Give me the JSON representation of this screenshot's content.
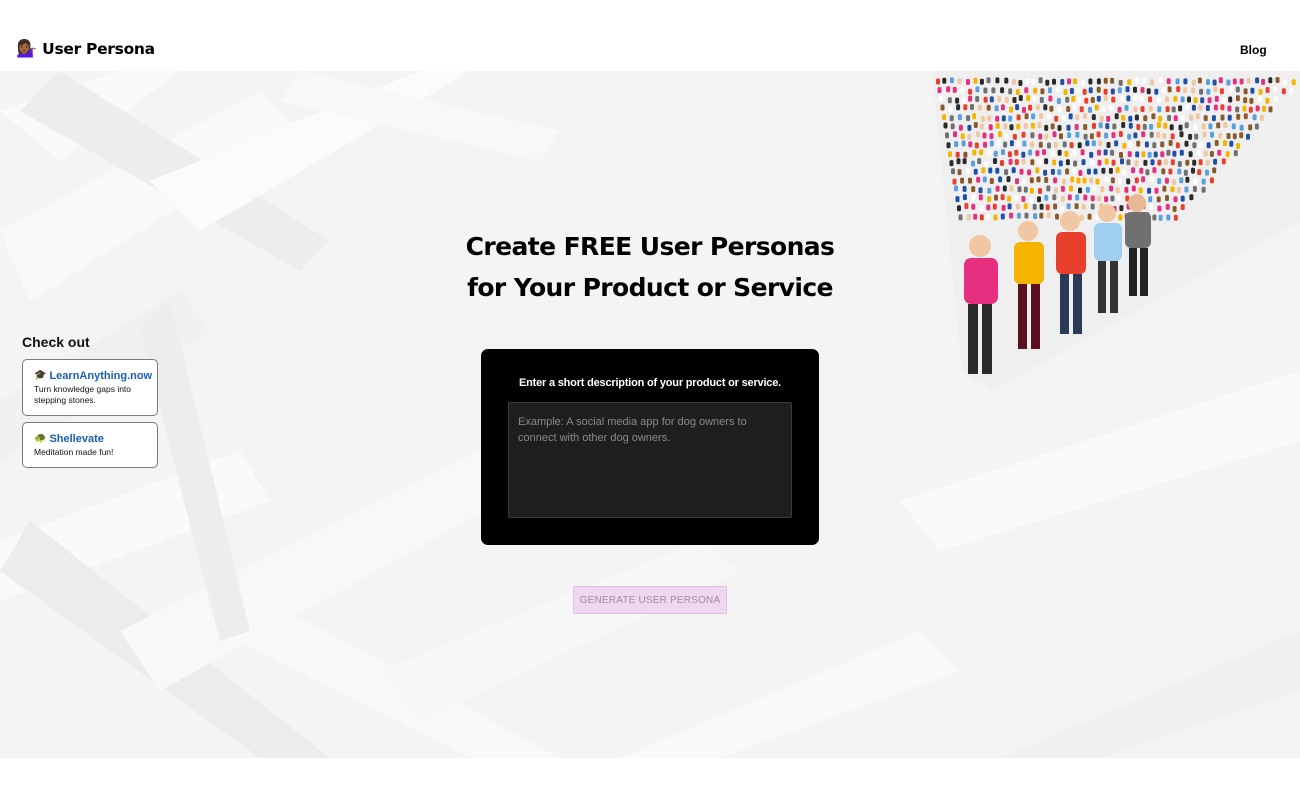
{
  "navbar": {
    "brand_emoji": "💁🏾‍♀️",
    "brand_name": "User Persona",
    "blog_link": "Blog"
  },
  "hero": {
    "headline_line1": "Create FREE User Personas",
    "headline_line2": "for Your Product or Service",
    "crowd_illustration": "crowd-of-people-illustration"
  },
  "checkout": {
    "title": "Check out",
    "items": [
      {
        "icon": "🎓",
        "icon_name": "graduation-cap-icon",
        "name": "LearnAnything.now",
        "description": "Turn knowledge gaps into stepping stones."
      },
      {
        "icon": "🐢",
        "icon_name": "turtle-icon",
        "name": "Shellevate",
        "description": "Meditation made fun!"
      }
    ]
  },
  "form": {
    "label": "Enter a short description of your product or service.",
    "placeholder": "Example: A social media app for dog owners to connect with other dog owners.",
    "value": "",
    "button_label": "GENERATE USER PERSONA"
  },
  "colors": {
    "panel_background": "#000000",
    "button_background": "#eed7ef",
    "link_blue": "#1a5fb4",
    "hero_background": "#f4f4f5"
  }
}
